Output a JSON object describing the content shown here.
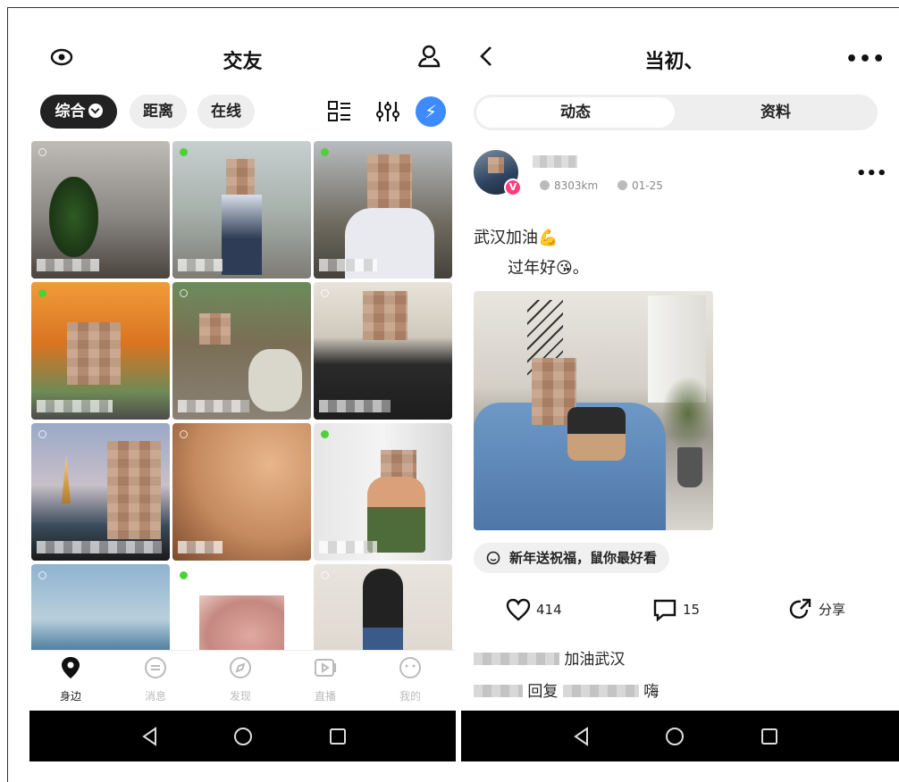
{
  "left": {
    "title": "交友",
    "filters": {
      "main": "综合",
      "distance": "距离",
      "online": "在线"
    },
    "tabs": [
      {
        "label": "身边",
        "icon": "location-pin-icon",
        "active": true
      },
      {
        "label": "消息",
        "icon": "chat-bubble-icon",
        "active": false
      },
      {
        "label": "发现",
        "icon": "compass-icon",
        "active": false
      },
      {
        "label": "直播",
        "icon": "live-video-icon",
        "active": false
      },
      {
        "label": "我的",
        "icon": "smile-icon",
        "active": false
      }
    ]
  },
  "right": {
    "title": "当初、",
    "tabs": {
      "feed": "动态",
      "profile": "资料"
    },
    "post": {
      "distance": "8303km",
      "date": "01-25",
      "line1": "武汉加油💪",
      "line2": "过年好😘。",
      "tag": "新年送祝福，鼠你最好看",
      "likes": "414",
      "comments": "15",
      "share": "分享"
    },
    "comments": [
      {
        "text": "加油武汉"
      },
      {
        "reply": "回复",
        "text": "嗨"
      }
    ]
  },
  "colors": {
    "accent": "#3d8bff",
    "online": "#4cd137",
    "vip": "#ff3d7f"
  }
}
